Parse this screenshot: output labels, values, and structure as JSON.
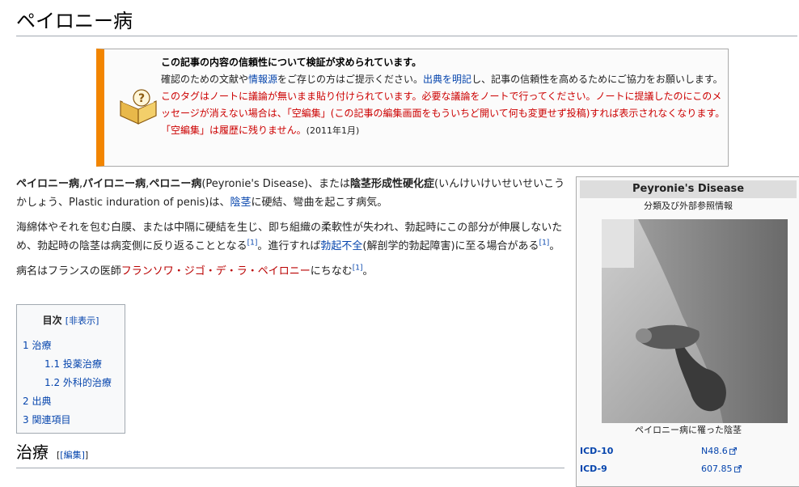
{
  "page": {
    "title": "ペイロニー病"
  },
  "ambox": {
    "title_pre": "この記事の内容の信頼性について",
    "title_link": "検証が求められています",
    "title_post": "。",
    "line1_a": "確認のための文献や",
    "line1_link1": "情報源",
    "line1_b": "をご存じの方はご提示ください。",
    "line1_link2": "出典を明記",
    "line1_c": "し、記事の信頼性を高めるためにご協力をお願いします。",
    "red_text": "このタグはノートに議論が無いまま貼り付けられています。必要な議論をノートで行ってください。ノートに提議したのにこのメッセージが消えない場合は、「空編集」(この記事の編集画面をもういちど開いて何も変更せず投稿)すれば表示されなくなります。「空編集」は履歴に残りません。",
    "date": "(2011年1月)"
  },
  "article": {
    "p1": {
      "b1": "ペイロニー病",
      "s1": ",",
      "b2": "パイロニー病",
      "s2": ",",
      "b3": "ペロニー病",
      "t1": "(Peyronie's Disease)、または",
      "b4": "陰茎形成性硬化症",
      "t2": "(いんけいけいせいせいこうかしょう、Plastic induration of penis)は、",
      "link": "陰茎",
      "t3": "に硬結、彎曲を起こす病気。"
    },
    "p2": {
      "t1": "海綿体やそれを包む白膜、または中隔に硬結を生じ、即ち組織の柔軟性が失われ、勃起時にこの部分が伸展しないため、勃起時の陰茎は病変側に反り返ることとなる",
      "ref1": "[1]",
      "t2": "。進行すれば",
      "link": "勃起不全",
      "t3": "(解剖学的勃起障害)に至る場合がある",
      "ref2": "[1]",
      "t4": "。"
    },
    "p3": {
      "t1": "病名はフランスの医師",
      "redlink": "フランソワ・ジゴ・デ・ラ・ペイロニー",
      "t2": "にちなむ",
      "ref": "[1]",
      "t3": "。"
    }
  },
  "toc": {
    "title": "目次",
    "toggle": "[非表示]",
    "items": [
      {
        "num": "1",
        "label": "治療"
      },
      {
        "num": "1.1",
        "label": "投薬治療"
      },
      {
        "num": "1.2",
        "label": "外科的治療"
      },
      {
        "num": "2",
        "label": "出典"
      },
      {
        "num": "3",
        "label": "関連項目"
      }
    ]
  },
  "section": {
    "title": "治療",
    "edit": "[編集]"
  },
  "infobox": {
    "title": "Peyronie's Disease",
    "subtitle": "分類及び外部参照情報",
    "caption": "ペイロニー病に罹った陰茎",
    "rows": [
      {
        "label": "ICD-10",
        "value": "N48.6"
      },
      {
        "label": "ICD-9",
        "value": "607.85"
      }
    ]
  },
  "colors": {
    "ambox_border": "#f28500",
    "link": "#0645ad",
    "redlink": "#ba0000",
    "warning_red": "#cc0000"
  }
}
